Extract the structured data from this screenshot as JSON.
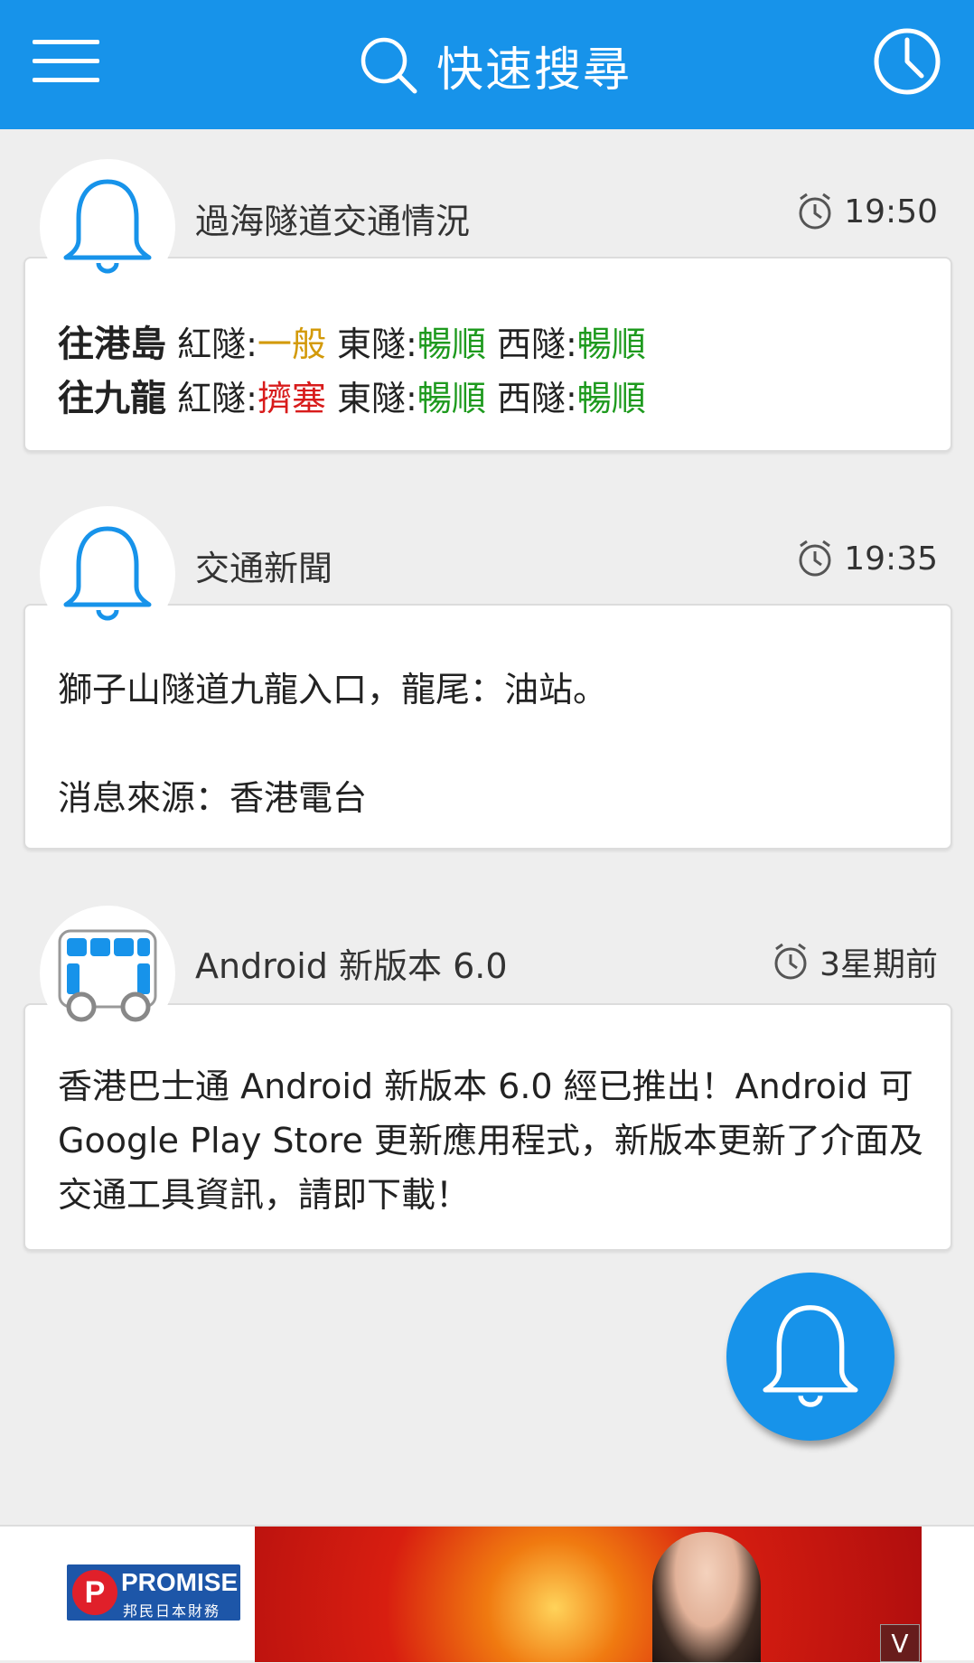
{
  "appbar": {
    "search_label": "快速搜尋"
  },
  "cards": [
    {
      "title": "過海隧道交通情況",
      "time": "19:50",
      "icon": "bell-icon",
      "rows": [
        {
          "direction": "往港島",
          "red_label": "紅隧:",
          "red_status": "一般",
          "red_color": "#d39a0a",
          "east_label": "東隧:",
          "east_status": "暢順",
          "east_color": "#1e9a1e",
          "west_label": "西隧:",
          "west_status": "暢順",
          "west_color": "#1e9a1e"
        },
        {
          "direction": "往九龍",
          "red_label": "紅隧:",
          "red_status": "擠塞",
          "red_color": "#d81b1b",
          "east_label": "東隧:",
          "east_status": "暢順",
          "east_color": "#1e9a1e",
          "west_label": "西隧:",
          "west_status": "暢順",
          "west_color": "#1e9a1e"
        }
      ]
    },
    {
      "title": "交通新聞",
      "time": "19:35",
      "icon": "bell-icon",
      "line1": "獅子山隧道九龍入口，龍尾：油站。",
      "line2": "消息來源：香港電台"
    },
    {
      "title": "Android 新版本 6.0",
      "time": "3星期前",
      "icon": "bus-icon",
      "body": "香港巴士通 Android 新版本 6.0 經已推出！Android 可 Google Play Store 更新應用程式，新版本更新了介面及交通工具資訊，請即下載！"
    }
  ],
  "ad": {
    "brand": "PROMISE",
    "brand_sub": "邦民日本財務",
    "close_label": "V"
  },
  "colors": {
    "primary": "#1793ea",
    "background": "#eeeeee"
  }
}
